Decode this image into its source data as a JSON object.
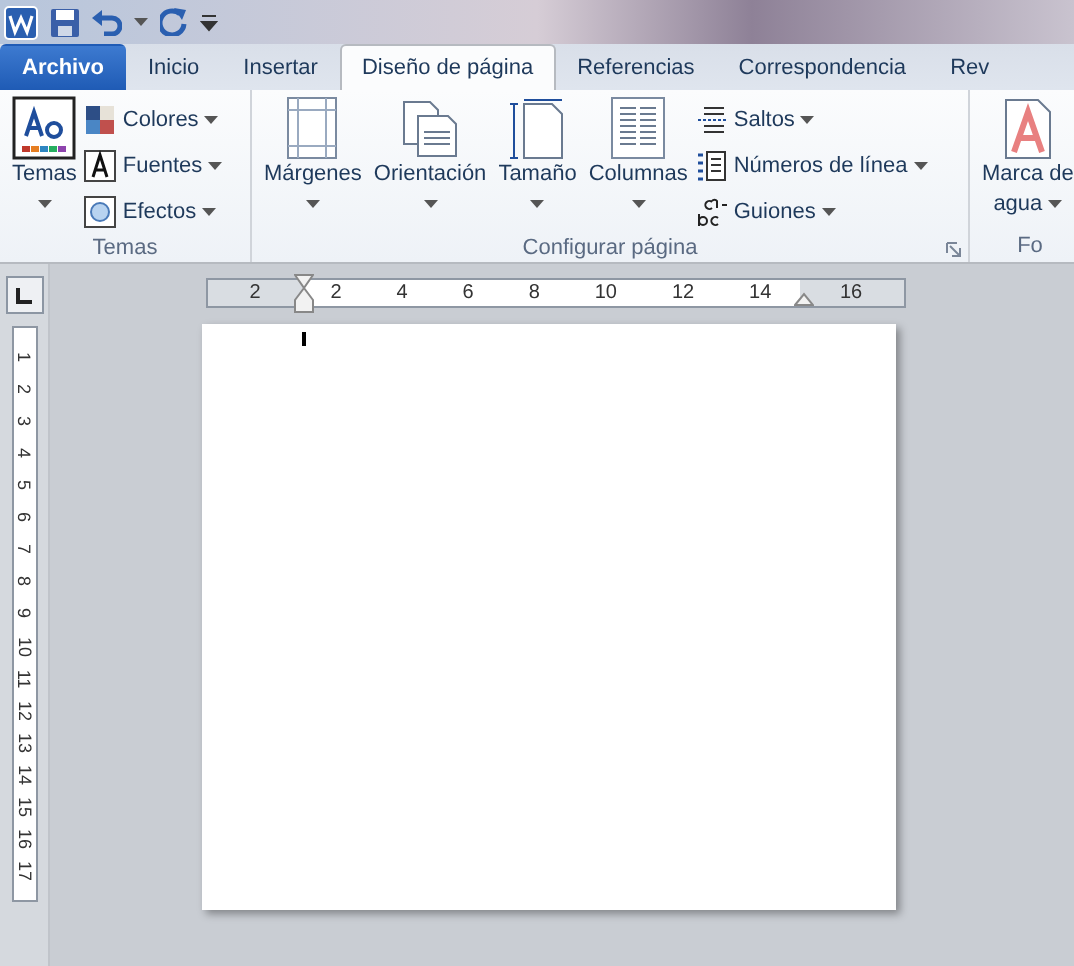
{
  "tabs": [
    {
      "label": "Archivo",
      "kind": "file",
      "selected": false
    },
    {
      "label": "Inicio",
      "kind": "tab",
      "selected": false
    },
    {
      "label": "Insertar",
      "kind": "tab",
      "selected": false
    },
    {
      "label": "Diseño de página",
      "kind": "tab",
      "selected": true
    },
    {
      "label": "Referencias",
      "kind": "tab",
      "selected": false
    },
    {
      "label": "Correspondencia",
      "kind": "tab",
      "selected": false
    },
    {
      "label": "Rev",
      "kind": "tab",
      "selected": false
    }
  ],
  "ribbon": {
    "groups": [
      {
        "label": "Temas",
        "large": [
          {
            "label": "Temas",
            "kind": "themes"
          }
        ],
        "small": [
          {
            "label": "Colores",
            "kind": "colors"
          },
          {
            "label": "Fuentes",
            "kind": "fonts"
          },
          {
            "label": "Efectos",
            "kind": "effects"
          }
        ]
      },
      {
        "label": "Configurar página",
        "large": [
          {
            "label": "Márgenes",
            "kind": "margins"
          },
          {
            "label": "Orientación",
            "kind": "orientation"
          },
          {
            "label": "Tamaño",
            "kind": "size"
          },
          {
            "label": "Columnas",
            "kind": "columns"
          }
        ],
        "small": [
          {
            "label": "Saltos",
            "kind": "breaks"
          },
          {
            "label": "Números de línea",
            "kind": "linenumbers"
          },
          {
            "label": "Guiones",
            "kind": "hyphen"
          }
        ],
        "launcher": true
      },
      {
        "label": "Fo",
        "large": [
          {
            "label": "Marca de agua",
            "kind": "watermark"
          }
        ]
      }
    ]
  },
  "horizontal_ruler": [
    "2",
    "2",
    "4",
    "6",
    "8",
    "10",
    "12",
    "14",
    "16"
  ],
  "vertical_ruler": [
    "1",
    "2",
    "3",
    "4",
    "5",
    "6",
    "7",
    "8",
    "9",
    "10",
    "11",
    "12",
    "13",
    "14",
    "15",
    "16",
    "17"
  ]
}
